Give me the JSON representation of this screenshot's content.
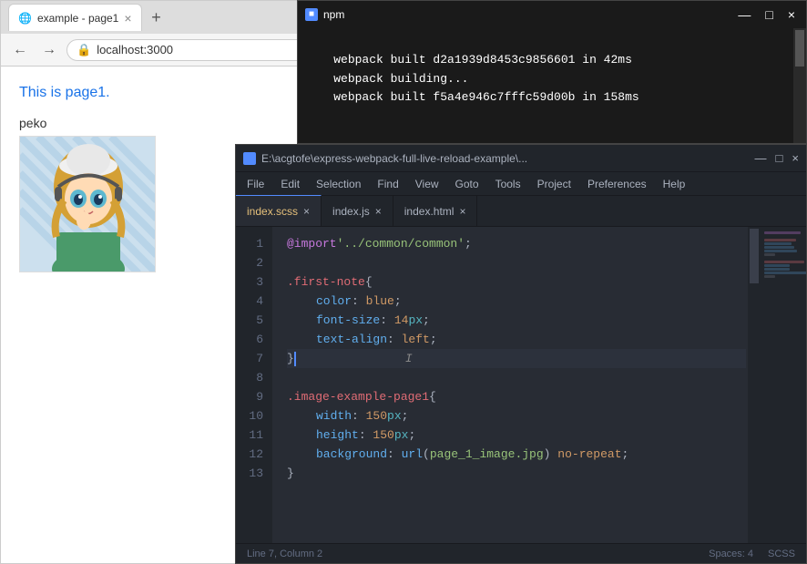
{
  "browser": {
    "tab_title": "example - page1",
    "tab_close": "×",
    "new_tab": "+",
    "back_icon": "←",
    "forward_icon": "→",
    "url": "localhost:3000",
    "page_heading": "This is page1.",
    "peko_label": "peko"
  },
  "cmd": {
    "title": "npm",
    "icon": "■",
    "minimize": "—",
    "maximize": "□",
    "close": "×",
    "lines": [
      "webpack built d2a1939d8453c9856601 in 42ms",
      "webpack building...",
      "webpack built f5a4e946c7fffc59d00b in 158ms"
    ]
  },
  "editor": {
    "title": "E:\\acgtofe\\express-webpack-full-live-reload-example\\...",
    "icon": "■",
    "minimize": "—",
    "maximize": "□",
    "close": "×",
    "menu": [
      "File",
      "Edit",
      "Selection",
      "Find",
      "View",
      "Goto",
      "Tools",
      "Project",
      "Preferences",
      "Help"
    ],
    "tabs": [
      {
        "name": "index.scss",
        "type": "scss",
        "active": true
      },
      {
        "name": "index.js",
        "type": "js",
        "active": false
      },
      {
        "name": "index.html",
        "type": "html",
        "active": false
      }
    ],
    "statusbar": {
      "position": "Line 7, Column 2",
      "spaces": "Spaces: 4",
      "language": "SCSS"
    }
  }
}
